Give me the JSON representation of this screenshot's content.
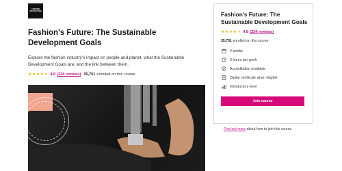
{
  "logo": {
    "line1": "FASHION",
    "line2": "REVOLUTION"
  },
  "course": {
    "title": "Fashion's Future: The Sustainable Development Goals",
    "description": "Explore the fashion industry's impact on people and planet, what the Sustainable Development Goals are, and the link between them.",
    "rating": {
      "value": "4.8",
      "reviews": "(234 reviews)",
      "stars_fraction": 0.96
    },
    "enrolled_count": "35,751",
    "enrolled_text": "enrolled on this course"
  },
  "panel": {
    "title": "Fashion's Future: The Sustainable Development Goals",
    "enrolled_count": "35,751",
    "enrolled_text": "enrolled on this course",
    "features": [
      {
        "icon": "calendar-icon",
        "label": "4 weeks"
      },
      {
        "icon": "clock-icon",
        "label": "3 hours per week"
      },
      {
        "icon": "accreditation-badge-icon",
        "label": "Accreditation available"
      },
      {
        "icon": "certificate-icon",
        "label": "Digital certificate when eligible"
      },
      {
        "icon": "level-bars-icon",
        "label": "Introductory level"
      }
    ],
    "join_label": "Join course"
  },
  "find_out": {
    "link": "Find out more",
    "text": "about how to join this course"
  },
  "colors": {
    "accent": "#d8097a",
    "link": "#c20b8a",
    "star": "#e8b800"
  }
}
